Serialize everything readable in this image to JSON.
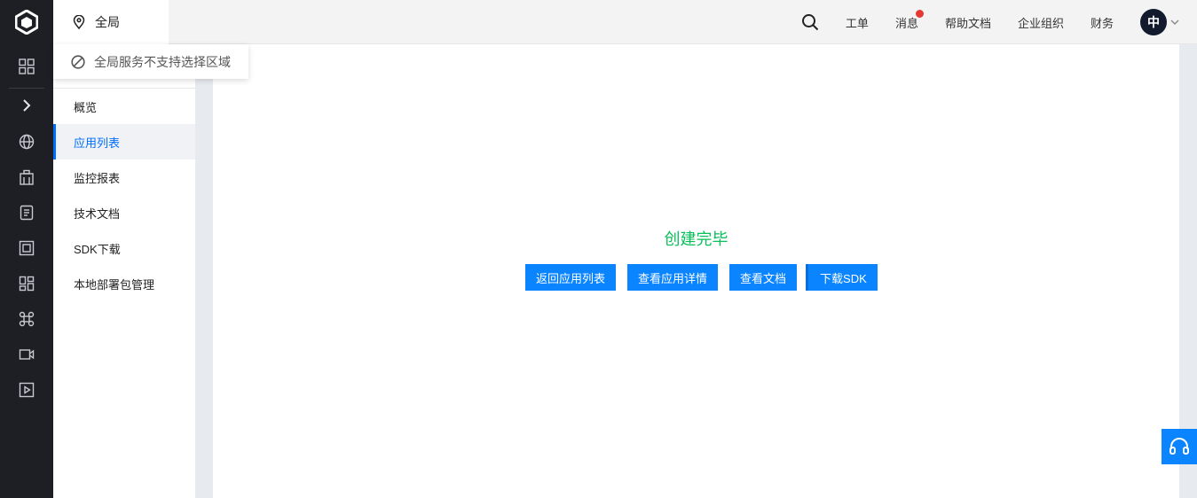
{
  "topbar": {
    "region_label": "全局",
    "nav": {
      "ticket": "工单",
      "messages": "消息",
      "help_docs": "帮助文档",
      "enterprise": "企业组织",
      "finance": "财务"
    },
    "avatar_text": "中",
    "messages_has_unread": true
  },
  "region_popup": {
    "text": "全局服务不支持选择区域"
  },
  "sidebar": {
    "items": [
      {
        "label": "概览"
      },
      {
        "label": "应用列表",
        "active": true
      },
      {
        "label": "监控报表"
      },
      {
        "label": "技术文档"
      },
      {
        "label": "SDK下载"
      },
      {
        "label": "本地部署包管理"
      }
    ]
  },
  "rail_icons": [
    "logo-icon",
    "grid-icon",
    "expand-chevron-icon",
    "globe-icon",
    "building-icon",
    "document-icon",
    "frame-icon",
    "dashboard-icon",
    "command-icon",
    "video-camera-icon",
    "play-icon"
  ],
  "main": {
    "status_title": "创建完毕",
    "buttons": {
      "back_to_list": "返回应用列表",
      "view_details": "查看应用详情",
      "view_docs": "查看文档",
      "download_sdk": "下载SDK"
    }
  },
  "colors": {
    "rail_bg": "#1e1f25",
    "accent": "#0a84ff",
    "success": "#0abf5b",
    "badge": "#e53935"
  }
}
